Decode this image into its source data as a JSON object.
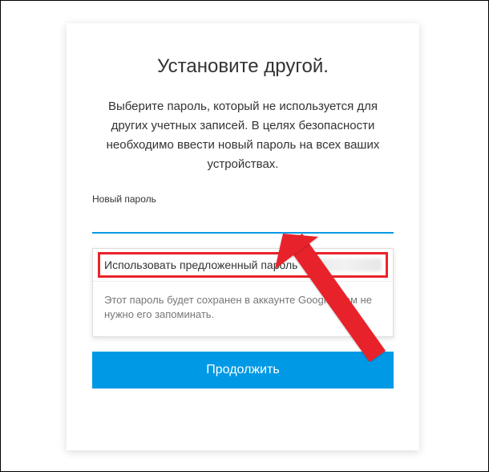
{
  "card": {
    "title": "Установите другой.",
    "description": "Выберите пароль, который не используется для других учетных записей. В целях безопасности необходимо ввести новый пароль на всех ваших устройствах."
  },
  "password_field": {
    "label": "Новый пароль",
    "value": ""
  },
  "suggestion": {
    "main_label": "Использовать предложенный пароль",
    "note": "Этот пароль будет сохранен в аккаунте Google. Вам не нужно его запоминать."
  },
  "continue_button": {
    "label": "Продолжить"
  },
  "colors": {
    "accent": "#0099e5",
    "highlight": "#e8232a"
  }
}
